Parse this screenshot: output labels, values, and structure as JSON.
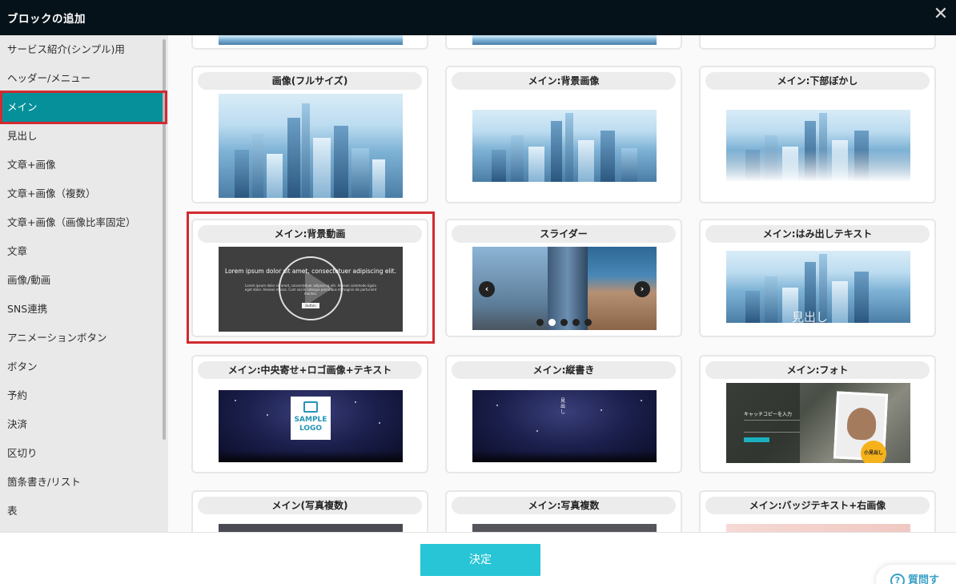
{
  "header": {
    "title": "ブロックの追加",
    "close_symbol": "✕"
  },
  "sidebar": {
    "items": [
      {
        "label": "サービス紹介(シンプル)用"
      },
      {
        "label": "ヘッダー/メニュー"
      },
      {
        "label": "メイン",
        "active": true
      },
      {
        "label": "見出し"
      },
      {
        "label": "文章+画像"
      },
      {
        "label": "文章+画像（複数）"
      },
      {
        "label": "文章+画像（画像比率固定）"
      },
      {
        "label": "文章"
      },
      {
        "label": "画像/動画"
      },
      {
        "label": "SNS連携"
      },
      {
        "label": "アニメーションボタン"
      },
      {
        "label": "ボタン"
      },
      {
        "label": "予約"
      },
      {
        "label": "決済"
      },
      {
        "label": "区切り"
      },
      {
        "label": "箇条書き/リスト"
      },
      {
        "label": "表"
      }
    ]
  },
  "blocks": [
    {
      "label": "画像(フルサイズ)"
    },
    {
      "label": "メイン:背景画像"
    },
    {
      "label": "メイン:下部ぼかし"
    },
    {
      "label": "メイン:背景動画",
      "highlighted": true
    },
    {
      "label": "スライダー"
    },
    {
      "label": "メイン:はみ出しテキスト"
    },
    {
      "label": "メイン:中央寄せ+ロゴ画像+テキスト"
    },
    {
      "label": "メイン:縦書き"
    },
    {
      "label": "メイン:フォト"
    },
    {
      "label": "メイン(写真複数)"
    },
    {
      "label": "メイン:写真複数"
    },
    {
      "label": "メイン:バッジテキスト+右画像"
    }
  ],
  "thumbs": {
    "video_title": "Lorem ipsum dolor sit amet, consectetuer adipiscing elit.",
    "video_body": "Lorem ipsum dolor sit amet, consectetuer adipiscing elit. Aenean commodo ligula eget dolor. Aenean massa. Cum sociis natoque penatibus et magnis dis parturient montes.",
    "video_button": "Button",
    "overlay_heading": "見出し",
    "logo_line1": "SAMPLE",
    "logo_line2": "LOGO",
    "vertical_text": "見出し",
    "photo_catch": "キャッチコピーを入力",
    "photo_badge": "小見出し"
  },
  "footer": {
    "confirm_label": "決定",
    "help_label": "質問す"
  },
  "icons": {
    "close": "close-icon",
    "slider_prev": "chevron-left-icon",
    "slider_next": "chevron-right-icon",
    "help": "question-icon",
    "play": "play-icon",
    "image": "image-icon"
  },
  "colors": {
    "header_bg": "#061219",
    "sidebar_active": "#06909a",
    "highlight_red": "#d22a30",
    "confirm_btn": "#27c5d6"
  }
}
